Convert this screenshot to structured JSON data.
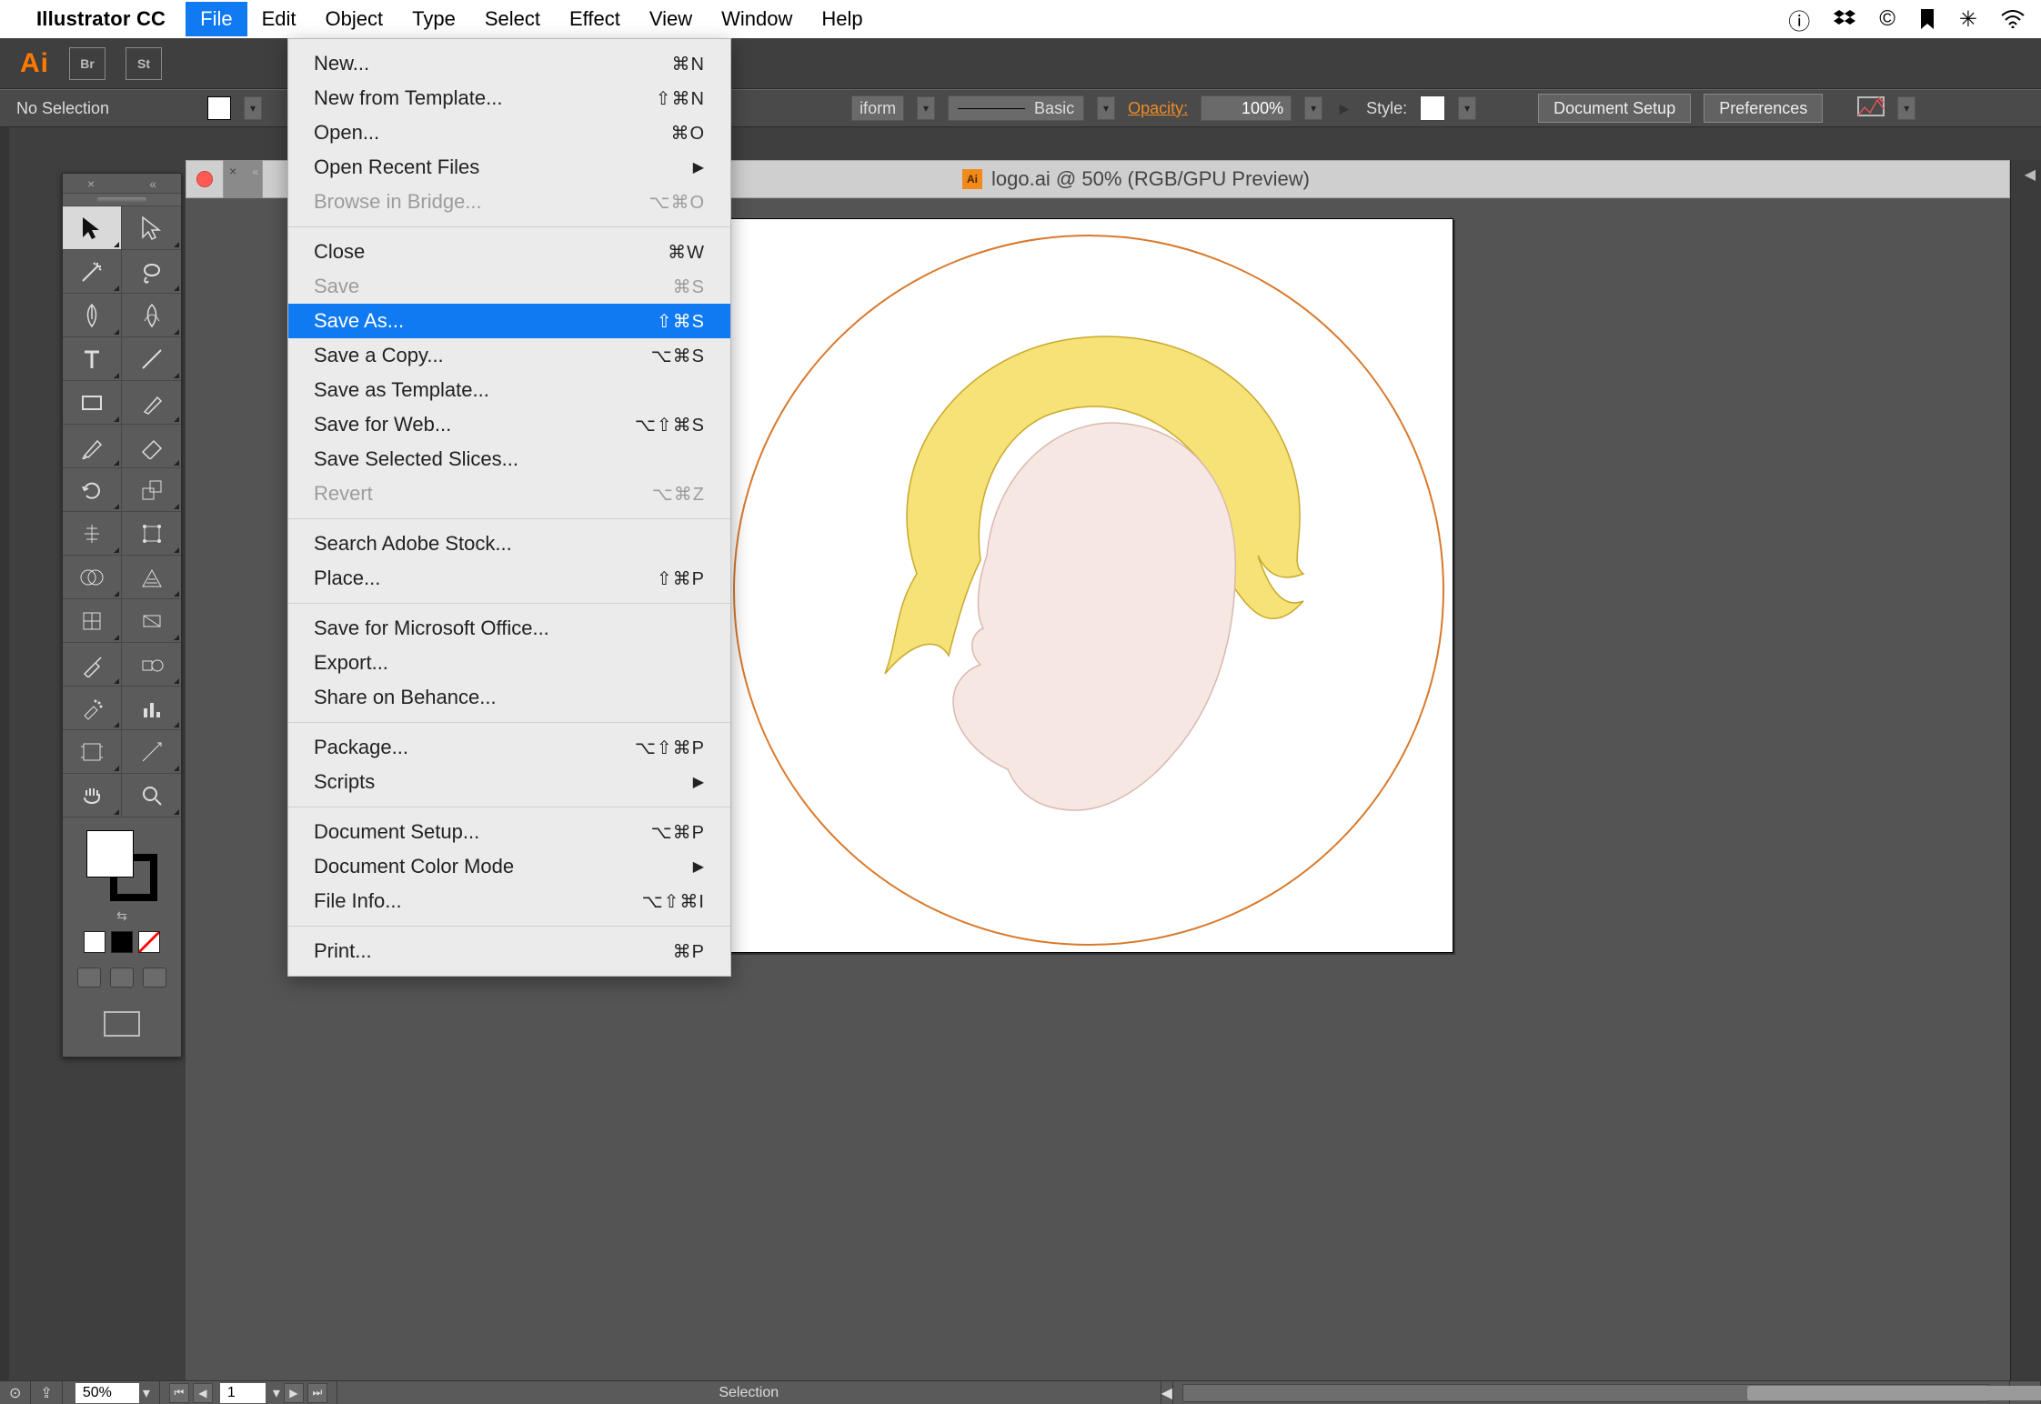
{
  "mac_menu": {
    "app_name": "Illustrator CC",
    "items": [
      "File",
      "Edit",
      "Object",
      "Type",
      "Select",
      "Effect",
      "View",
      "Window",
      "Help"
    ],
    "open_index": 0
  },
  "app_bar": {
    "ai": "Ai",
    "chips": [
      "Br",
      "St"
    ]
  },
  "ctrl": {
    "selection": "No Selection",
    "iform": "iform",
    "brush_name": "Basic",
    "opacity_label": "Opacity:",
    "opacity_value": "100%",
    "style_label": "Style:",
    "doc_setup": "Document Setup",
    "prefs": "Preferences"
  },
  "doc": {
    "title": "logo.ai @ 50% (RGB/GPU Preview)",
    "badge": "Ai"
  },
  "file_menu": [
    {
      "label": "New...",
      "shortcut": "⌘N"
    },
    {
      "label": "New from Template...",
      "shortcut": "⇧⌘N"
    },
    {
      "label": "Open...",
      "shortcut": "⌘O"
    },
    {
      "label": "Open Recent Files",
      "shortcut": "▶",
      "sub": true
    },
    {
      "label": "Browse in Bridge...",
      "shortcut": "⌥⌘O",
      "disabled": true
    },
    {
      "sep": true
    },
    {
      "label": "Close",
      "shortcut": "⌘W"
    },
    {
      "label": "Save",
      "shortcut": "⌘S",
      "disabled": true
    },
    {
      "label": "Save As...",
      "shortcut": "⇧⌘S",
      "highlight": true
    },
    {
      "label": "Save a Copy...",
      "shortcut": "⌥⌘S"
    },
    {
      "label": "Save as Template..."
    },
    {
      "label": "Save for Web...",
      "shortcut": "⌥⇧⌘S"
    },
    {
      "label": "Save Selected Slices..."
    },
    {
      "label": "Revert",
      "shortcut": "⌥⌘Z",
      "disabled": true
    },
    {
      "sep": true
    },
    {
      "label": "Search Adobe Stock..."
    },
    {
      "label": "Place...",
      "shortcut": "⇧⌘P"
    },
    {
      "sep": true
    },
    {
      "label": "Save for Microsoft Office..."
    },
    {
      "label": "Export..."
    },
    {
      "label": "Share on Behance..."
    },
    {
      "sep": true
    },
    {
      "label": "Package...",
      "shortcut": "⌥⇧⌘P"
    },
    {
      "label": "Scripts",
      "shortcut": "▶",
      "sub": true
    },
    {
      "sep": true
    },
    {
      "label": "Document Setup...",
      "shortcut": "⌥⌘P"
    },
    {
      "label": "Document Color Mode",
      "shortcut": "▶",
      "sub": true
    },
    {
      "label": "File Info...",
      "shortcut": "⌥⇧⌘I"
    },
    {
      "sep": true
    },
    {
      "label": "Print...",
      "shortcut": "⌘P"
    }
  ],
  "status": {
    "zoom": "50%",
    "artboard": "1",
    "mode": "Selection"
  },
  "tools": [
    "selection",
    "direct-selection",
    "magic-wand",
    "lasso",
    "pen",
    "curvature",
    "type",
    "line-segment",
    "rectangle",
    "paintbrush",
    "pencil",
    "eraser",
    "rotate",
    "scale",
    "width",
    "free-transform",
    "shape-builder",
    "perspective-grid",
    "mesh",
    "gradient",
    "eyedropper",
    "blend",
    "symbol-sprayer",
    "column-graph",
    "artboard",
    "slice",
    "hand",
    "zoom"
  ]
}
